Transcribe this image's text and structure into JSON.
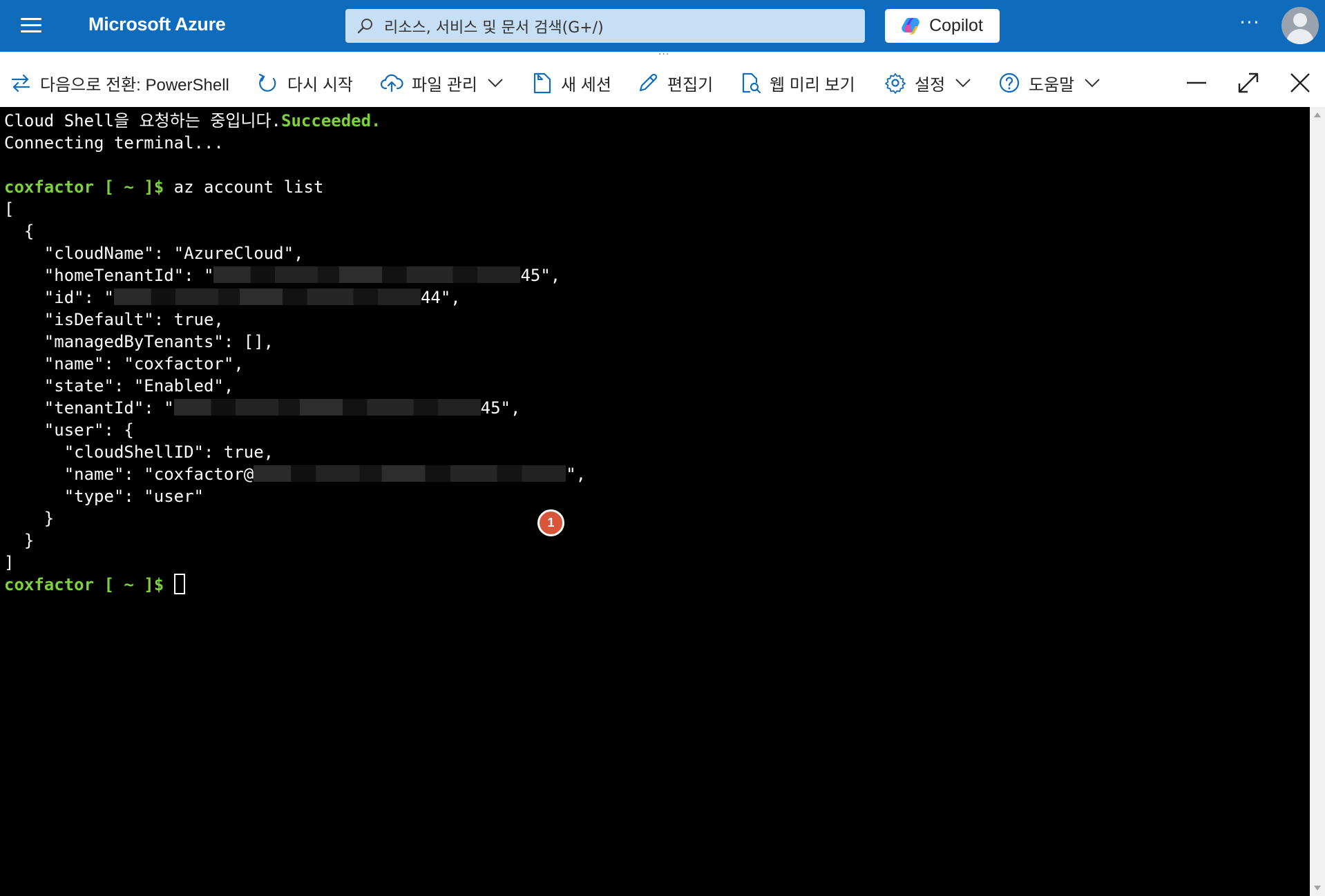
{
  "header": {
    "menu_icon": "hamburger-menu-icon",
    "brand": "Microsoft Azure",
    "search": {
      "placeholder": "리소스, 서비스 및 문서 검색(G+/)",
      "icon": "search-icon"
    },
    "copilot_label": "Copilot",
    "more_label": "···",
    "avatar_icon": "user-avatar-icon",
    "color": "#0f6cbd"
  },
  "splitter": {
    "grip": "···"
  },
  "toolbar": {
    "switch_label": "다음으로 전환: PowerShell",
    "restart_label": "다시 시작",
    "files_label": "파일 관리",
    "new_session_label": "새 세션",
    "editor_label": "편집기",
    "web_preview_label": "웹 미리 보기",
    "settings_label": "설정",
    "help_label": "도움말",
    "icons": [
      "switch-icon",
      "restart-icon",
      "cloud-upload-icon",
      "new-session-icon",
      "pencil-icon",
      "web-preview-icon",
      "gear-icon",
      "help-icon",
      "minimize-icon",
      "maximize-icon",
      "close-icon"
    ]
  },
  "terminal": {
    "request_text": "Cloud Shell을 요청하는 중입니다.",
    "request_status": "Succeeded.",
    "connecting": "Connecting terminal...",
    "prompt_user": "coxfactor",
    "prompt_rest": " [ ~ ]$",
    "command": " az account list",
    "open_bracket": "[",
    "open_brace": "  {",
    "cloud_name": "    \"cloudName\": \"AzureCloud\",",
    "home_tenant_prefix": "    \"homeTenantId\": \"",
    "home_tenant_suffix": "45\",",
    "id_prefix": "    \"id\": \"",
    "id_suffix": "44\",",
    "is_default": "    \"isDefault\": true,",
    "managed_by": "    \"managedByTenants\": [],",
    "name_line": "    \"name\": \"coxfactor\",",
    "state_line": "    \"state\": \"Enabled\",",
    "tenant_prefix": "    \"tenantId\": \"",
    "tenant_suffix": "45\",",
    "user_open": "    \"user\": {",
    "cloud_shell_id": "      \"cloudShellID\": true,",
    "user_name_prefix": "      \"name\": \"coxfactor@",
    "user_name_suffix": "\",",
    "user_type": "      \"type\": \"user\"",
    "inner_close": "    }",
    "outer_close": "  }",
    "close_bracket": "]",
    "prompt_color": "#7bd23a"
  },
  "annotation": {
    "step": "1",
    "color": "#d9553a"
  }
}
